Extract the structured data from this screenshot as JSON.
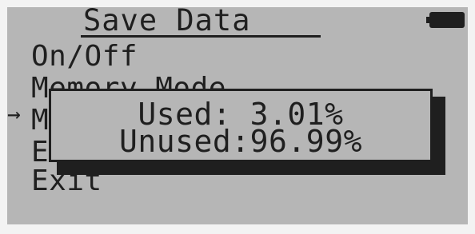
{
  "screen": {
    "title": "Save Data",
    "battery_icon": "battery-full-icon",
    "cursor_glyph": "→"
  },
  "menu": {
    "items": [
      {
        "label": "On/Off"
      },
      {
        "label": "Memory Mode"
      },
      {
        "label": "M"
      },
      {
        "label": "E"
      },
      {
        "label": "Exit"
      }
    ],
    "selected_index": 2
  },
  "popup": {
    "used_line": "Used: 3.01%",
    "unused_line": "Unused:96.99%"
  },
  "colors": {
    "lcd_background": "#b6b6b6",
    "pixel_color": "#1f1f1f",
    "bezel": "#f3f3f3"
  }
}
